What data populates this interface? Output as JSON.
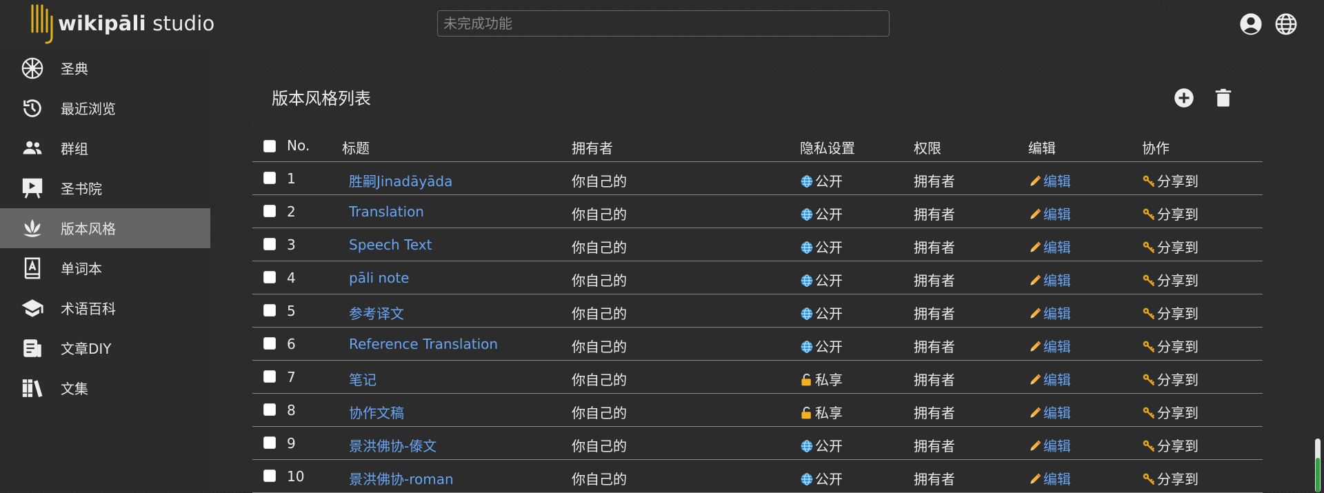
{
  "app": {
    "name_bold": "wikipāli",
    "name_rest": " studio"
  },
  "search": {
    "placeholder": "未完成功能"
  },
  "header_icons": [
    "account-icon",
    "globe-icon"
  ],
  "sidebar": {
    "items": [
      {
        "label": "圣典",
        "icon": "dharma-wheel-icon"
      },
      {
        "label": "最近浏览",
        "icon": "history-icon"
      },
      {
        "label": "群组",
        "icon": "group-icon"
      },
      {
        "label": "圣书院",
        "icon": "presentation-icon"
      },
      {
        "label": "版本风格",
        "icon": "lotus-icon",
        "active": true
      },
      {
        "label": "单词本",
        "icon": "dictionary-icon"
      },
      {
        "label": "术语百科",
        "icon": "school-icon"
      },
      {
        "label": "文章DIY",
        "icon": "article-icon"
      },
      {
        "label": "文集",
        "icon": "books-icon"
      }
    ]
  },
  "card": {
    "title": "版本风格列表",
    "add_icon": "add-circle-icon",
    "delete_icon": "trash-icon"
  },
  "table": {
    "headers": {
      "no": "No.",
      "title": "标题",
      "owner": "拥有者",
      "privacy": "隐私设置",
      "permission": "权限",
      "edit": "编辑",
      "collab": "协作"
    },
    "rows": [
      {
        "no": "1",
        "title": "胜嗣Jinadāyāda",
        "owner": "你自己的",
        "privacy": "公开",
        "privacy_icon": "globe-icon",
        "permission": "拥有者",
        "edit": "编辑",
        "collab": "分享到"
      },
      {
        "no": "2",
        "title": "Translation",
        "owner": "你自己的",
        "privacy": "公开",
        "privacy_icon": "globe-icon",
        "permission": "拥有者",
        "edit": "编辑",
        "collab": "分享到"
      },
      {
        "no": "3",
        "title": "Speech Text",
        "owner": "你自己的",
        "privacy": "公开",
        "privacy_icon": "globe-icon",
        "permission": "拥有者",
        "edit": "编辑",
        "collab": "分享到"
      },
      {
        "no": "4",
        "title": "pāli note",
        "owner": "你自己的",
        "privacy": "公开",
        "privacy_icon": "globe-icon",
        "permission": "拥有者",
        "edit": "编辑",
        "collab": "分享到"
      },
      {
        "no": "5",
        "title": "参考译文",
        "owner": "你自己的",
        "privacy": "公开",
        "privacy_icon": "globe-icon",
        "permission": "拥有者",
        "edit": "编辑",
        "collab": "分享到"
      },
      {
        "no": "6",
        "title": "Reference Translation",
        "owner": "你自己的",
        "privacy": "公开",
        "privacy_icon": "globe-icon",
        "permission": "拥有者",
        "edit": "编辑",
        "collab": "分享到"
      },
      {
        "no": "7",
        "title": "笔记",
        "owner": "你自己的",
        "privacy": "私享",
        "privacy_icon": "lock-icon",
        "permission": "拥有者",
        "edit": "编辑",
        "collab": "分享到"
      },
      {
        "no": "8",
        "title": "协作文稿",
        "owner": "你自己的",
        "privacy": "私享",
        "privacy_icon": "lock-icon",
        "permission": "拥有者",
        "edit": "编辑",
        "collab": "分享到"
      },
      {
        "no": "9",
        "title": "景洪佛协-傣文",
        "owner": "你自己的",
        "privacy": "公开",
        "privacy_icon": "globe-icon",
        "permission": "拥有者",
        "edit": "编辑",
        "collab": "分享到"
      },
      {
        "no": "10",
        "title": "景洪佛协-roman",
        "owner": "你自己的",
        "privacy": "公开",
        "privacy_icon": "globe-icon",
        "permission": "拥有者",
        "edit": "编辑",
        "collab": "分享到"
      }
    ]
  },
  "colors": {
    "link": "#69a6f5",
    "active_nav": "#656565",
    "logo_accent": "#e2b21f"
  }
}
